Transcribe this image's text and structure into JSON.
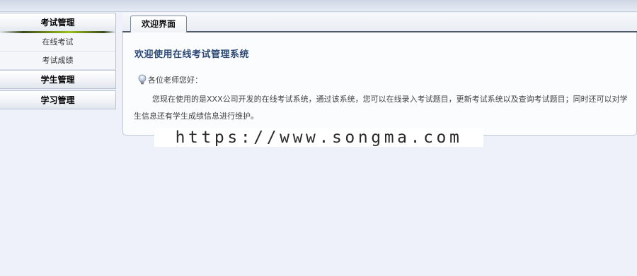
{
  "sidebar": {
    "groups": [
      {
        "label": "考试管理",
        "items": [
          "在线考试",
          "考试成绩"
        ]
      },
      {
        "label": "学生管理"
      },
      {
        "label": "学习管理"
      }
    ]
  },
  "main": {
    "tab_label": "欢迎界面",
    "title": "欢迎使用在线考试管理系统",
    "greeting": "各位老师您好：",
    "body": "您现在使用的是XXX公司开发的在线考试系统，通过该系统，您可以在线录入考试题目，更新考试系统以及查询考试题目；同时还可以对学生信息还有学生成绩信息进行维护。"
  },
  "watermark": "https://www.songma.com",
  "icons": {
    "greeting_icon": "lightbulb-icon"
  },
  "colors": {
    "title": "#2d4a75",
    "tab_border": "#4c5a6c",
    "background": "#eef1f9"
  }
}
